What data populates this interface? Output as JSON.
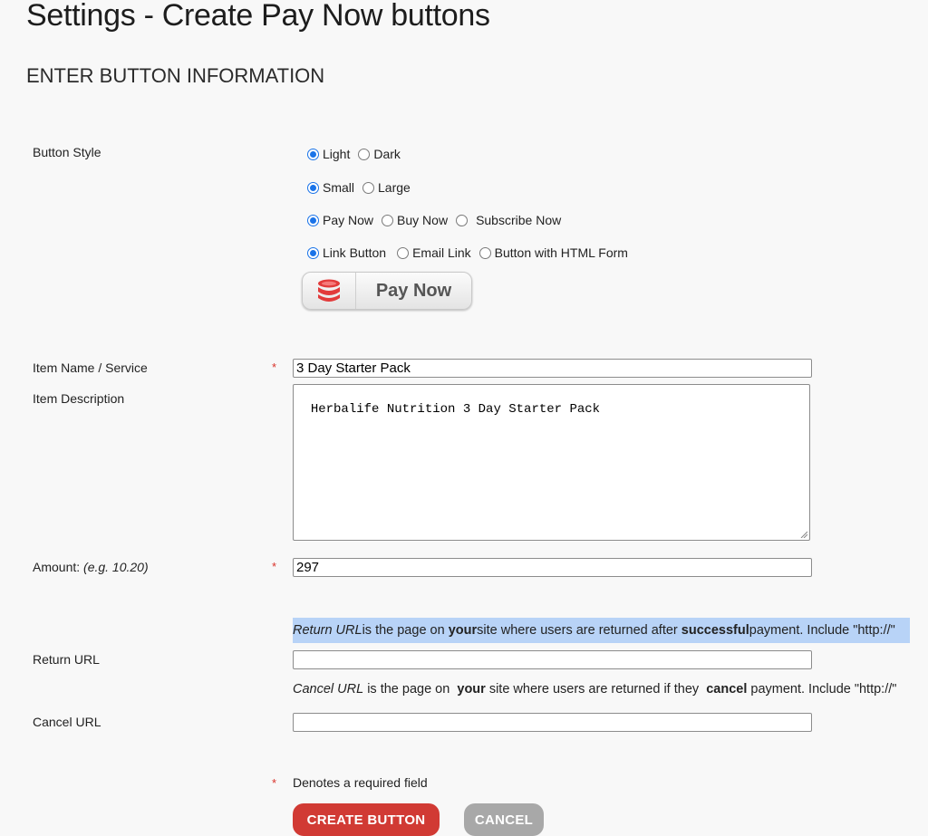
{
  "page_title": "Settings - Create Pay Now buttons",
  "section_title": "ENTER BUTTON INFORMATION",
  "button_style": {
    "label": "Button Style",
    "rows": [
      [
        {
          "label": "Light",
          "checked": true
        },
        {
          "label": "Dark",
          "checked": false
        }
      ],
      [
        {
          "label": "Small",
          "checked": true
        },
        {
          "label": "Large",
          "checked": false
        }
      ],
      [
        {
          "label": "Pay Now",
          "checked": true
        },
        {
          "label": "Buy Now",
          "checked": false
        },
        {
          "label": "Subscribe Now",
          "checked": false
        }
      ],
      [
        {
          "label": "Link Button",
          "checked": true
        },
        {
          "label": "Email Link",
          "checked": false
        },
        {
          "label": "Button with HTML Form",
          "checked": false
        }
      ]
    ],
    "preview_label": "Pay Now",
    "preview_icon": "database-stack-icon",
    "preview_icon_color": "#e23b3b"
  },
  "form": {
    "item_name_label": "Item Name / Service",
    "item_name_value": "3 Day Starter Pack",
    "item_description_label": "Item Description",
    "item_description_value": "Herbalife Nutrition 3 Day Starter Pack",
    "amount_label": "Amount:",
    "amount_hint": "(e.g. 10.20)",
    "amount_value": "297",
    "required_marker": "*",
    "return_help": {
      "part1": "Return URL",
      "part2": " is the page on ",
      "part3": "your",
      "part4": " site where users are returned after ",
      "part5": "successful",
      "part6": " payment. Include \"http://\""
    },
    "return_url_label": "Return URL",
    "return_url_value": "",
    "cancel_help": {
      "part1": "Cancel URL",
      "part2": " is the page on ",
      "part3": "your",
      "part4": " site where users are returned if they ",
      "part5": "cancel",
      "part6": " payment. Include \"http://\""
    },
    "cancel_url_label": "Cancel URL",
    "cancel_url_value": "",
    "required_note": "Denotes a required field"
  },
  "actions": {
    "create_label": "CREATE BUTTON",
    "cancel_label": "CANCEL"
  },
  "colors": {
    "primary_button": "#d13a34",
    "secondary_button": "#a8a8a8",
    "highlight": "#b8d3f7",
    "required": "#d9322a",
    "radio_selected": "#1a73e8"
  }
}
